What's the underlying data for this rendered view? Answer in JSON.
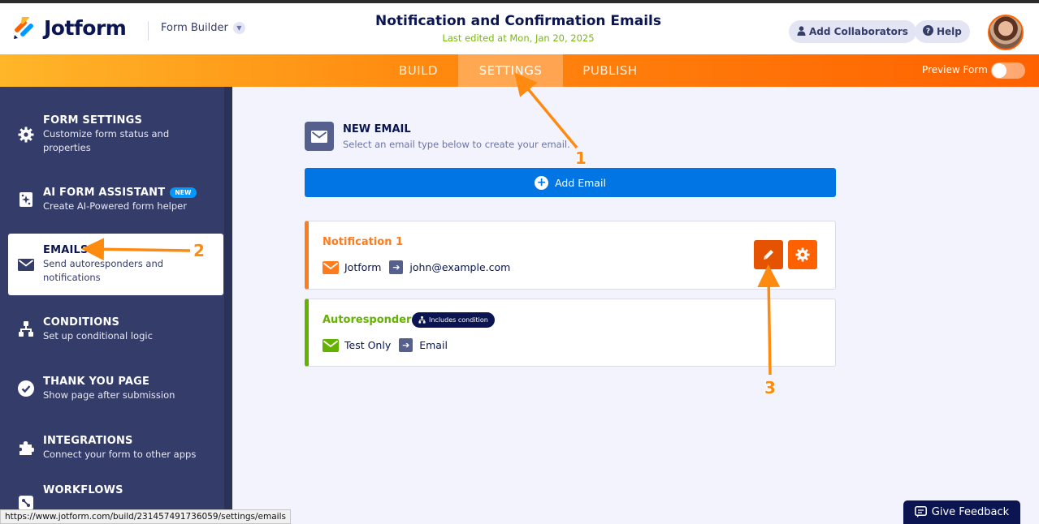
{
  "header": {
    "logo_text": "Jotform",
    "form_builder_label": "Form Builder",
    "title": "Notification and Confirmation Emails",
    "last_edited": "Last edited at Mon, Jan 20, 2025",
    "add_collaborators_label": "Add Collaborators",
    "help_label": "Help"
  },
  "nav": {
    "tabs": [
      {
        "label": "BUILD",
        "active": false
      },
      {
        "label": "SETTINGS",
        "active": true
      },
      {
        "label": "PUBLISH",
        "active": false
      }
    ],
    "preview_label": "Preview Form",
    "preview_enabled": false
  },
  "sidebar": {
    "items": [
      {
        "title": "FORM SETTINGS",
        "desc": "Customize form status and properties",
        "icon": "gear-icon"
      },
      {
        "title": "AI FORM ASSISTANT",
        "badge": "NEW",
        "desc": "Create AI-Powered form helper",
        "icon": "ai-sparkle-icon"
      },
      {
        "title": "EMAILS",
        "desc": "Send autoresponders and notifications",
        "icon": "envelope-icon",
        "active": true
      },
      {
        "title": "CONDITIONS",
        "desc": "Set up conditional logic",
        "icon": "hierarchy-icon"
      },
      {
        "title": "THANK YOU PAGE",
        "desc": "Show page after submission",
        "icon": "check-circle-icon"
      },
      {
        "title": "INTEGRATIONS",
        "desc": "Connect your form to other apps",
        "icon": "puzzle-icon"
      },
      {
        "title": "WORKFLOWS",
        "desc": "",
        "icon": "workflow-icon"
      }
    ]
  },
  "main": {
    "new_email_title": "NEW EMAIL",
    "new_email_subtitle": "Select an email type below to create your email.",
    "add_email_label": "Add Email",
    "cards": [
      {
        "name": "Notification 1",
        "from": "Jotform",
        "to": "john@example.com",
        "type": "notification",
        "color": "#ff7b1c"
      },
      {
        "name": "Autoresponder 1",
        "badge": "Includes condition",
        "from": "Test Only",
        "to": "Email",
        "type": "autoresponder",
        "color": "#64b200"
      }
    ]
  },
  "annotations": {
    "labels": [
      "1",
      "2",
      "3"
    ],
    "color": "#ff8a10"
  },
  "status_url": "https://www.jotform.com/build/231457491736059/settings/emails",
  "feedback_label": "Give Feedback"
}
